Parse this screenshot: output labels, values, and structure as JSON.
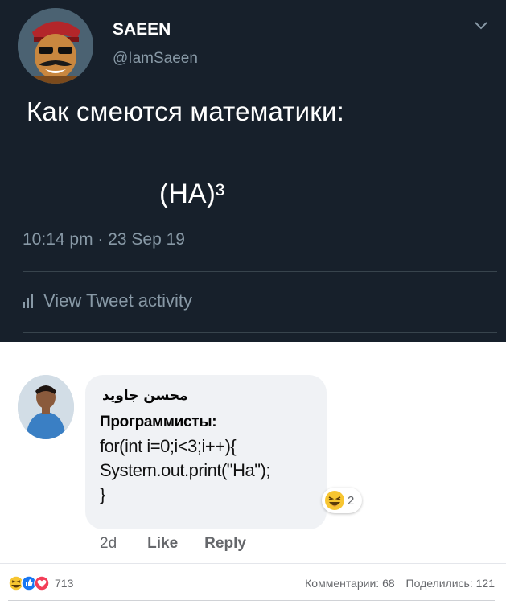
{
  "tweet": {
    "display_name": "SAEEN",
    "handle": "@IamSaeen",
    "text": "Как смеются математики:",
    "formula": "(HA)³",
    "timestamp": "10:14 pm · 23 Sep 19",
    "activity_label": "View Tweet activity",
    "icons": [
      "chevron-down-icon",
      "bar-chart-icon"
    ],
    "colors": {
      "background": "#17202b",
      "muted": "#8899a6"
    }
  },
  "facebook": {
    "commenter": "محسن جاوید",
    "comment_heading": "Программисты:",
    "code_lines": [
      "for(int i=0;i<3;i++){",
      "System.out.print(\"Ha\");",
      "}"
    ],
    "reaction_count": "2",
    "time": "2d",
    "like_label": "Like",
    "reply_label": "Reply",
    "post_reaction_count": "713",
    "comments_label": "Комментарии: 68",
    "shares_label": "Поделились: 121",
    "icons": [
      "laughing-emoji-icon",
      "like-icon",
      "love-icon"
    ]
  }
}
